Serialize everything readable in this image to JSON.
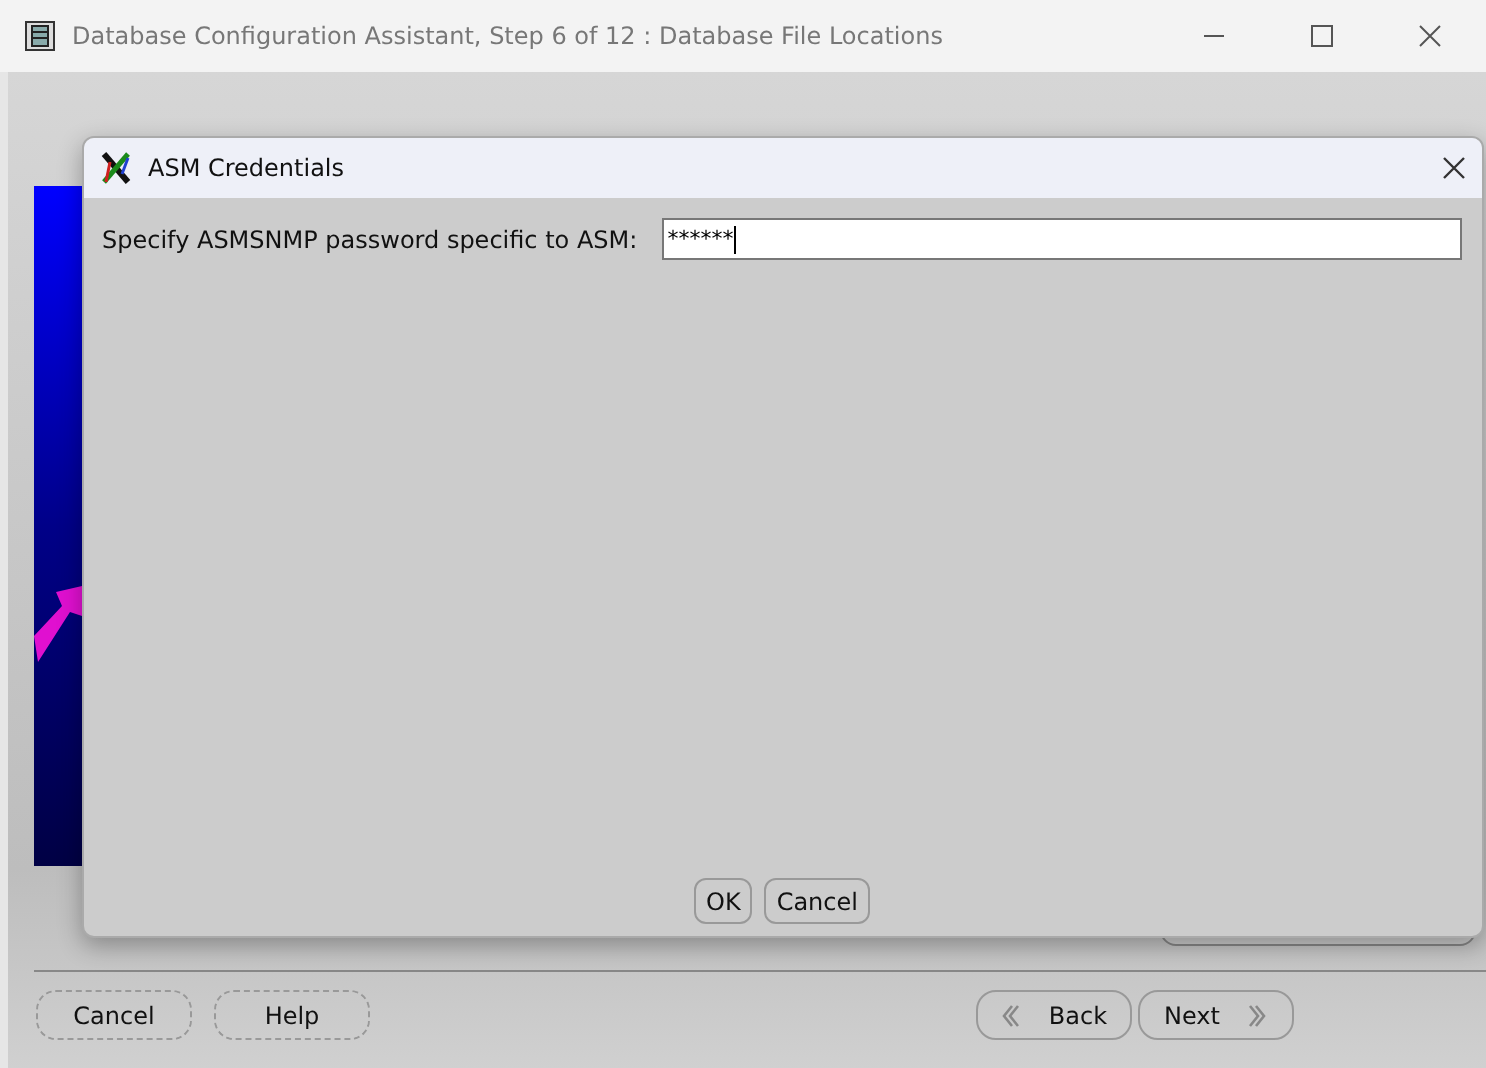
{
  "window": {
    "title": "Database Configuration Assistant, Step 6 of 12 : Database File Locations"
  },
  "bottom_buttons": {
    "left": [
      "Cancel",
      "Help"
    ],
    "back": "Back",
    "next": "Next"
  },
  "dialog": {
    "title": "ASM Credentials",
    "label": "Specify ASMSNMP password specific to ASM:",
    "password": "******",
    "buttons": [
      "OK",
      "Cancel"
    ]
  }
}
